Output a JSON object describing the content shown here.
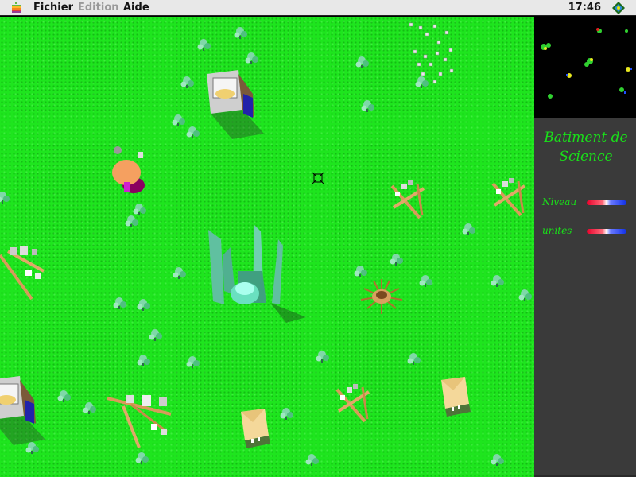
{
  "menubar": {
    "menus": [
      "Fichier",
      "Edition",
      "Aide"
    ],
    "clock": "17:46"
  },
  "panel": {
    "title_line1": "Batiment de",
    "title_line2": "Science",
    "stats": [
      {
        "label": "Niveau"
      },
      {
        "label": "unites"
      }
    ]
  },
  "colors": {
    "grass": "#1ee51e",
    "panel_bg": "#3a3a3a",
    "panel_text": "#19e019",
    "minimap_bg": "#000000"
  },
  "icons": [
    "apple-menu-icon",
    "app-switcher-icon"
  ]
}
